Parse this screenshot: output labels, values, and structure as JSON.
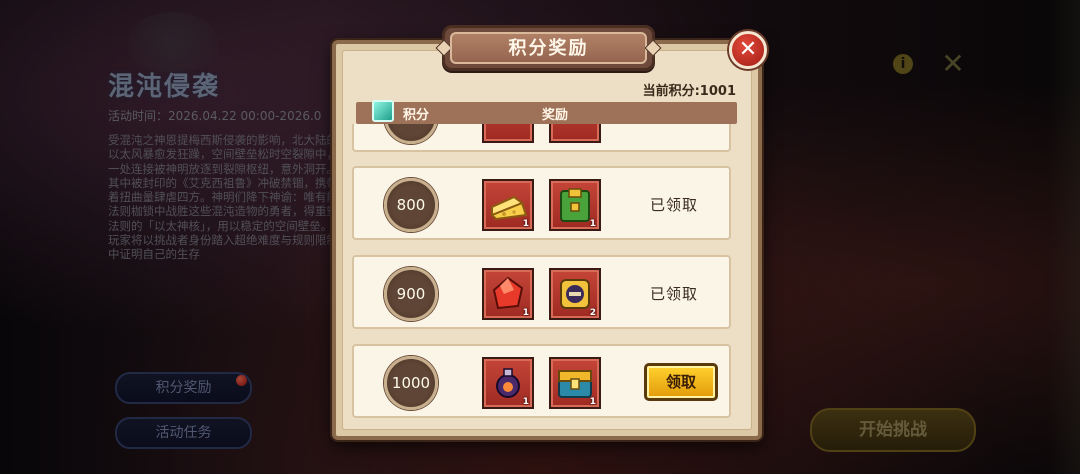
{
  "background": {
    "event_title": "混沌侵袭",
    "event_time": "活动时间：2026.04.22 00:00-2026.0",
    "event_description": "受混沌之神恩提梅西斯侵袭的影响，北大陆的以太风暴愈发狂躁，空间壁垒松时空裂隙中，一处连接被神明放逐到裂隙枢纽，意外洞开。其中被封印的《艾克西祖鲁》冲破禁锢，携带着扭曲量肆虐四方。神明们降下神谕：唯有能法则枷锁中战胜这些混沌造物的勇者，得重塑法则的「以太神核」，用以稳定的空间壁垒。玩家将以挑战者身份踏入超绝难度与规则限制中证明自己的生存",
    "points_reward_button": "积分奖励",
    "event_tasks_button": "活动任务",
    "start_challenge_button": "开始挑战",
    "info_icon": "info-icon",
    "cross_icon": "crossed-swords-icon"
  },
  "modal": {
    "title": "积分奖励",
    "current_points_label": "当前积分:1001",
    "header_points": "积分",
    "header_rewards": "奖励",
    "close_icon": "close-icon",
    "rows": [
      {
        "points": "",
        "items": [
          {
            "icon": "red-item-icon",
            "qty": ""
          },
          {
            "icon": "red-item-icon",
            "qty": ""
          }
        ],
        "status": "",
        "partial": true
      },
      {
        "points": "800",
        "items": [
          {
            "icon": "cheese-icon",
            "qty": "1"
          },
          {
            "icon": "green-armor-icon",
            "qty": "1"
          }
        ],
        "status": "已领取"
      },
      {
        "points": "900",
        "items": [
          {
            "icon": "red-crystal-icon",
            "qty": "1"
          },
          {
            "icon": "helmet-token-icon",
            "qty": "2"
          }
        ],
        "status": "已领取"
      },
      {
        "points": "1000",
        "items": [
          {
            "icon": "potion-icon",
            "qty": "1"
          },
          {
            "icon": "treasure-chest-icon",
            "qty": "1"
          }
        ],
        "status": "",
        "action": "领取"
      }
    ]
  }
}
